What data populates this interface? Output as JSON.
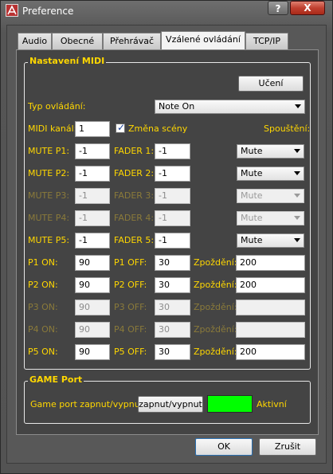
{
  "window": {
    "title": "Preference",
    "help_label": "?",
    "close_label": "X"
  },
  "tabs": [
    "Audio",
    "Obecné",
    "Přehrávač",
    "Vzálené ovládání",
    "TCP/IP"
  ],
  "midi": {
    "group_title": "Nastavení MIDI",
    "learn_label": "Učení",
    "control_type_label": "Typ ovládání:",
    "control_type_value": "Note On",
    "channel_label": "MIDI kanál:",
    "channel_value": "1",
    "scene_change_label": "Změna scény",
    "scene_change_checked": true,
    "trigger_label": "Spouštění:",
    "mute_rows": [
      {
        "mute_label": "MUTE P1:",
        "mute_value": "-1",
        "fader_label": "FADER 1:",
        "fader_value": "-1",
        "trigger": "Mute",
        "enabled": true
      },
      {
        "mute_label": "MUTE P2:",
        "mute_value": "-1",
        "fader_label": "FADER 2:",
        "fader_value": "-1",
        "trigger": "Mute",
        "enabled": true
      },
      {
        "mute_label": "MUTE P3:",
        "mute_value": "-1",
        "fader_label": "FADER 3:",
        "fader_value": "-1",
        "trigger": "Mute",
        "enabled": false
      },
      {
        "mute_label": "MUTE P4:",
        "mute_value": "-1",
        "fader_label": "FADER 4:",
        "fader_value": "-1",
        "trigger": "Mute",
        "enabled": false
      },
      {
        "mute_label": "MUTE P5:",
        "mute_value": "-1",
        "fader_label": "FADER 5:",
        "fader_value": "-1",
        "trigger": "Mute",
        "enabled": true
      }
    ],
    "pad_rows": [
      {
        "on_label": "P1 ON:",
        "on_value": "90",
        "off_label": "P1 OFF:",
        "off_value": "30",
        "delay_label": "Zpoždění:",
        "delay_value": "200",
        "enabled": true
      },
      {
        "on_label": "P2 ON:",
        "on_value": "90",
        "off_label": "P2 OFF:",
        "off_value": "30",
        "delay_label": "Zpoždění:",
        "delay_value": "200",
        "enabled": true
      },
      {
        "on_label": "P3 ON:",
        "on_value": "90",
        "off_label": "P3 OFF:",
        "off_value": "30",
        "delay_label": "Zpoždění:",
        "delay_value": "",
        "enabled": false
      },
      {
        "on_label": "P4 ON:",
        "on_value": "90",
        "off_label": "P4 OFF:",
        "off_value": "30",
        "delay_label": "Zpoždění:",
        "delay_value": "",
        "enabled": false
      },
      {
        "on_label": "P5 ON:",
        "on_value": "90",
        "off_label": "P5 OFF:",
        "off_value": "30",
        "delay_label": "Zpoždění:",
        "delay_value": "200",
        "enabled": true
      }
    ]
  },
  "game_port": {
    "group_title": "GAME Port",
    "toggle_label": "Game port zapnut/vypnut:",
    "toggle_button": "zapnut/vypnut",
    "status_label": "Aktivní",
    "indicator_color": "#00ff00"
  },
  "footer": {
    "ok_label": "OK",
    "cancel_label": "Zrušit"
  }
}
